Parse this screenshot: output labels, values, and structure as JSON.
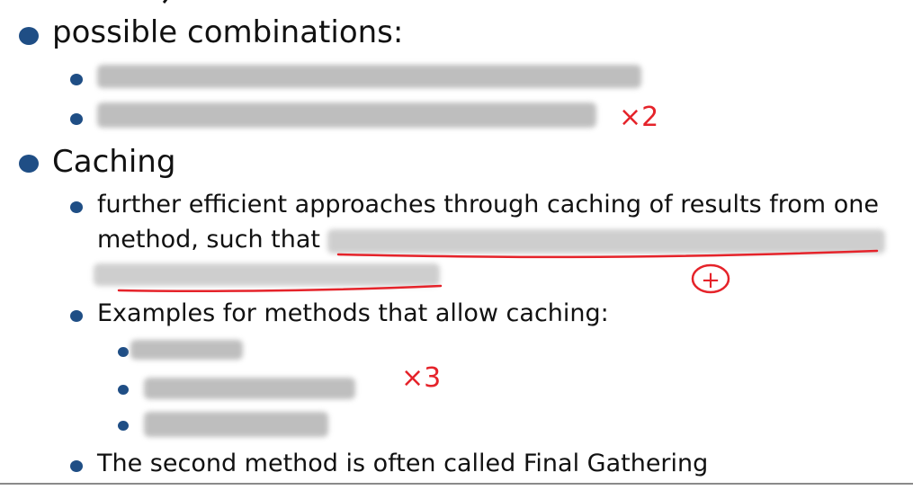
{
  "items": {
    "combinations_heading": "possible combinations:",
    "caching_heading": "Caching",
    "caching_line1": "further efficient approaches through caching of results from one",
    "caching_line2": "method, such that",
    "examples_heading": "Examples for methods that allow caching:",
    "final_note": "The second method is often called Final Gathering"
  },
  "annotations": {
    "combinations_mark": "×2",
    "examples_mark": "×3",
    "plus_mark": "+"
  },
  "colors": {
    "bullet": "#1f4e85",
    "annotation": "#e5232a",
    "text": "#111111"
  }
}
